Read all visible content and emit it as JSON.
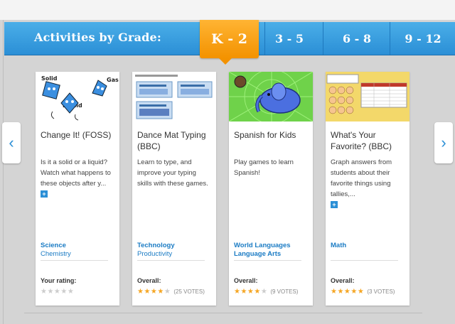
{
  "header": {
    "title": "Activities by Grade:",
    "grades": [
      {
        "label": "K - 2",
        "active": true
      },
      {
        "label": "3 - 5",
        "active": false
      },
      {
        "label": "6 - 8",
        "active": false
      },
      {
        "label": "9 - 12",
        "active": false
      }
    ]
  },
  "nav": {
    "prev": "‹",
    "next": "›"
  },
  "cards": [
    {
      "title": "Change It! (FOSS)",
      "description": "Is it a solid or a liquid? Watch what happens to these objects after y...",
      "subject": "Science",
      "topic": "Chemistry",
      "rating_label": "Your rating:",
      "stars": 0,
      "votes": "",
      "thumb_words": [
        "Solid",
        "Liquid",
        "Gas"
      ]
    },
    {
      "title": "Dance Mat Typing (BBC)",
      "description": "Learn to type, and improve your typing skills with these games.",
      "subject": "Technology",
      "topic": "Productivity",
      "rating_label": "Overall:",
      "stars": 4.5,
      "votes": "(25 VOTES)"
    },
    {
      "title": "Spanish for Kids",
      "description": "Play games to learn Spanish!",
      "subject": "World Languages",
      "topic": "Language Arts",
      "rating_label": "Overall:",
      "stars": 4,
      "votes": "(9 VOTES)"
    },
    {
      "title": "What's Your Favorite? (BBC)",
      "description": "Graph answers from students about their favorite things using tallies,...",
      "subject": "Math",
      "topic": "",
      "rating_label": "Overall:",
      "stars": 5,
      "votes": "(3 VOTES)"
    }
  ],
  "colors": {
    "header": "#2b8fd6",
    "active_tab": "#f39200",
    "link": "#1a7bc4",
    "star": "#f5a623"
  }
}
